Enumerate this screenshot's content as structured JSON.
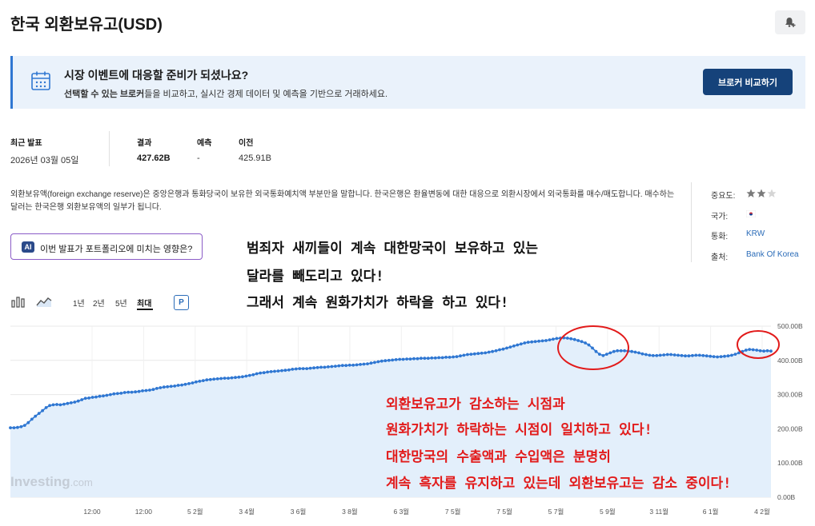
{
  "page": {
    "title": "한국 외환보유고(USD)"
  },
  "banner": {
    "title": "시장 이벤트에 대응할 준비가 되셨나요?",
    "sub_bold": "선택할 수 있는 브로커",
    "sub_rest": "들을 비교하고, 실시간 경제 데이터 및 예측을 기반으로 거래하세요.",
    "button": "브로커 비교하기"
  },
  "stats": {
    "latest_label": "최근 발표",
    "latest_value": "2026년 03월 05일",
    "actual_label": "결과",
    "actual_value": "427.62B",
    "forecast_label": "예측",
    "forecast_value": "-",
    "previous_label": "이전",
    "previous_value": "425.91B"
  },
  "description": "외환보유액(foreign exchange reserve)은 중앙은행과 통화당국이 보유한 외국통화예치액 부분만을 말합니다. 한국은행은 환율변동에 대한 대응으로 외환시장에서 외국통화를 매수/매도합니다. 매수하는 달러는 한국은행 외환보유액의 일부가 됩니다.",
  "side": {
    "importance_label": "중요도:",
    "country_label": "국가:",
    "currency_label": "통화:",
    "currency_value": "KRW",
    "source_label": "출처:",
    "source_value": "Bank Of Korea"
  },
  "ai_button": {
    "badge": "AI",
    "text": "이번 발표가 포트폴리오에 미치는 영향은?"
  },
  "annotations": {
    "black": [
      "범죄자 새끼들이 계속 대한망국이 보유하고 있는",
      "달라를 빼도리고 있다!",
      "그래서 계속 원화가치가 하락을 하고 있다!"
    ],
    "red": [
      "외환보유고가 감소하는 시점과",
      "원화가치가 하락하는 시점이 일치하고 있다!",
      "대한망국의 수출액과 수입액은 분명히",
      "계속 흑자를 유지하고 있는데 외환보유고는 감소 중이다!"
    ]
  },
  "toolbar": {
    "ranges": [
      "1년",
      "2년",
      "5년",
      "최대"
    ],
    "active_range": "최대",
    "p_button": "P"
  },
  "watermark": {
    "brand": "Investing",
    "suffix": ".com"
  },
  "colors": {
    "line": "#2f77d2",
    "area": "#e3effb",
    "annotation_red": "#e21b1b",
    "button_dark": "#15427a"
  },
  "chart_data": {
    "type": "area",
    "ylim": [
      0,
      500
    ],
    "y_ticks": [
      "500.00B",
      "400.00B",
      "300.00B",
      "200.00B",
      "100.00B",
      "0.00B"
    ],
    "y_tick_values": [
      500,
      400,
      300,
      200,
      100,
      0
    ],
    "x_tick_labels": [
      "12:00",
      "12:00",
      "5 2월",
      "3 4월",
      "3 6월",
      "3 8월",
      "6 3월",
      "7 5월",
      "7 5월",
      "5 7월",
      "5 9월",
      "3 11월",
      "6 1월",
      "4 2월"
    ],
    "grid": true,
    "series": [
      {
        "values": [
          203,
          203,
          204,
          206,
          210,
          218,
          228,
          237,
          245,
          253,
          262,
          268,
          270,
          271,
          270,
          272,
          274,
          276,
          278,
          281,
          285,
          289,
          290,
          292,
          293,
          295,
          296,
          298,
          300,
          302,
          303,
          304,
          306,
          307,
          307,
          308,
          309,
          311,
          312,
          313,
          315,
          318,
          320,
          322,
          323,
          324,
          325,
          327,
          328,
          330,
          332,
          334,
          337,
          339,
          341,
          343,
          344,
          345,
          346,
          347,
          348,
          348,
          349,
          350,
          351,
          352,
          354,
          356,
          358,
          361,
          363,
          364,
          366,
          367,
          368,
          369,
          370,
          371,
          372,
          374,
          375,
          376,
          376,
          376,
          377,
          378,
          379,
          380,
          380,
          381,
          382,
          383,
          384,
          385,
          385,
          386,
          386,
          387,
          388,
          389,
          390,
          392,
          394,
          396,
          398,
          399,
          400,
          401,
          402,
          403,
          403,
          404,
          404,
          405,
          405,
          406,
          406,
          406,
          407,
          407,
          408,
          408,
          409,
          409,
          410,
          411,
          413,
          415,
          417,
          418,
          419,
          420,
          421,
          422,
          424,
          426,
          428,
          431,
          433,
          436,
          439,
          442,
          445,
          448,
          451,
          453,
          454,
          455,
          456,
          457,
          458,
          460,
          462,
          464,
          465,
          466,
          465,
          463,
          461,
          458,
          455,
          451,
          445,
          436,
          426,
          418,
          414,
          418,
          422,
          426,
          428,
          428,
          428,
          427,
          426,
          424,
          422,
          419,
          417,
          415,
          414,
          414,
          415,
          416,
          417,
          417,
          416,
          415,
          414,
          413,
          413,
          414,
          415,
          415,
          414,
          413,
          412,
          411,
          410,
          411,
          412,
          413,
          415,
          418,
          422,
          426,
          430,
          432,
          431,
          430,
          428,
          427,
          428,
          427
        ]
      }
    ]
  }
}
